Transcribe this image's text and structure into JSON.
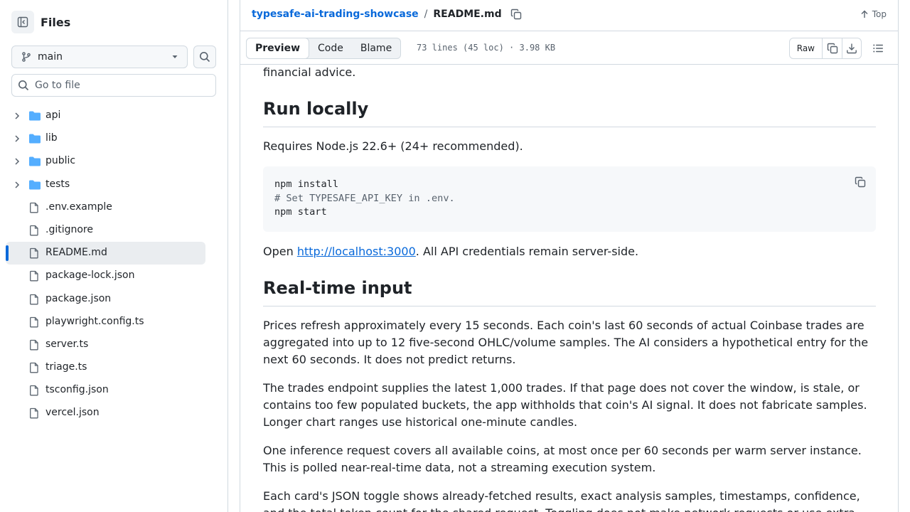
{
  "sidebar": {
    "title": "Files",
    "branch": "main",
    "goto_placeholder": "Go to file",
    "items": [
      {
        "label": "api",
        "type": "folder"
      },
      {
        "label": "lib",
        "type": "folder"
      },
      {
        "label": "public",
        "type": "folder"
      },
      {
        "label": "tests",
        "type": "folder"
      },
      {
        "label": ".env.example",
        "type": "file"
      },
      {
        "label": ".gitignore",
        "type": "file"
      },
      {
        "label": "README.md",
        "type": "file",
        "selected": true
      },
      {
        "label": "package-lock.json",
        "type": "file"
      },
      {
        "label": "package.json",
        "type": "file"
      },
      {
        "label": "playwright.config.ts",
        "type": "file"
      },
      {
        "label": "server.ts",
        "type": "file"
      },
      {
        "label": "triage.ts",
        "type": "file"
      },
      {
        "label": "tsconfig.json",
        "type": "file"
      },
      {
        "label": "vercel.json",
        "type": "file"
      }
    ]
  },
  "header": {
    "repo": "typesafe-ai-trading-showcase",
    "separator": "/",
    "file": "README.md",
    "top_label": "Top"
  },
  "toolbar": {
    "tabs": [
      "Preview",
      "Code",
      "Blame"
    ],
    "active_tab": "Preview",
    "meta": "73 lines (45 loc) · 3.98 KB",
    "raw_label": "Raw"
  },
  "readme": {
    "intro_tail": "financial advice.",
    "section1_title": "Run locally",
    "requires": "Requires Node.js 22.6+ (24+ recommended).",
    "code_lines": [
      "npm install",
      "# Set TYPESAFE_API_KEY in .env.",
      "npm start"
    ],
    "open_prefix": "Open ",
    "open_link": "http://localhost:3000",
    "open_suffix": ". All API credentials remain server-side.",
    "section2_title": "Real-time input",
    "para1": "Prices refresh approximately every 15 seconds. Each coin's last 60 seconds of actual Coinbase trades are aggregated into up to 12 five-second OHLC/volume samples. The AI considers a hypothetical entry for the next 60 seconds. It does not predict returns.",
    "para2": "The trades endpoint supplies the latest 1,000 trades. If that page does not cover the window, is stale, or contains too few populated buckets, the app withholds that coin's AI signal. It does not fabricate samples. Longer chart ranges use historical one-minute candles.",
    "para3": "One inference request covers all available coins, at most once per 60 seconds per warm server instance. This is polled near-real-time data, not a streaming execution system.",
    "para4": "Each card's JSON toggle shows already-fetched results, exact analysis samples, timestamps, confidence, and the total token count for the shared request. Toggling does not make network requests or use extra"
  },
  "colors": {
    "accent": "#0969da",
    "folder": "#54aeff",
    "muted": "#59636e",
    "border": "#d1d9e0"
  }
}
